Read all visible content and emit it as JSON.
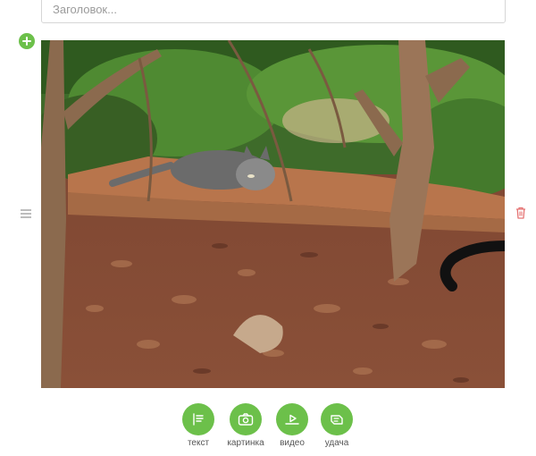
{
  "title_field": {
    "placeholder": "Заголовок..."
  },
  "block": {
    "add_icon": "plus-icon",
    "drag_icon": "drag-handle-icon",
    "delete_icon": "trash-icon",
    "image_alt": "photo"
  },
  "toolbar": {
    "items": [
      {
        "label": "текст",
        "icon": "text-icon"
      },
      {
        "label": "картинка",
        "icon": "camera-icon"
      },
      {
        "label": "видео",
        "icon": "video-icon"
      },
      {
        "label": "удача",
        "icon": "luck-icon"
      }
    ]
  },
  "colors": {
    "accent": "#6cc04a",
    "delete": "#e57373",
    "border": "#d6d6d6"
  }
}
